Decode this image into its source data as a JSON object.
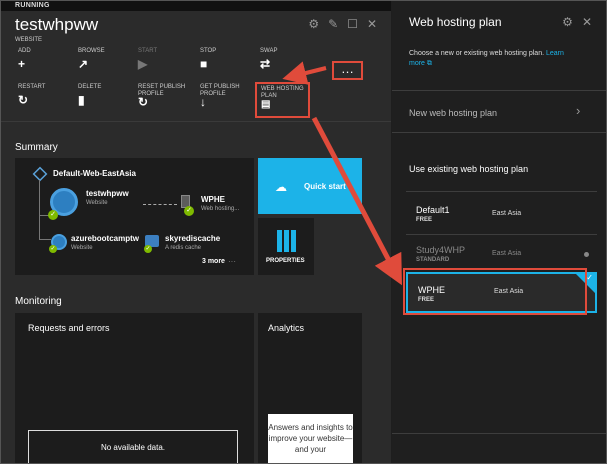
{
  "left": {
    "status": "RUNNING",
    "title": "testwhpww",
    "subtitle": "WEBSITE",
    "commands_row1": [
      {
        "label": "ADD",
        "icon": "plus-icon",
        "glyph": "+"
      },
      {
        "label": "BROWSE",
        "icon": "external-link-icon",
        "glyph": "↗"
      },
      {
        "label": "START",
        "icon": "play-icon",
        "glyph": "▶"
      },
      {
        "label": "STOP",
        "icon": "stop-icon",
        "glyph": "■"
      },
      {
        "label": "SWAP",
        "icon": "swap-icon",
        "glyph": "⇄"
      }
    ],
    "commands_row2": [
      {
        "label": "RESTART",
        "icon": "restart-icon",
        "glyph": "↻"
      },
      {
        "label": "DELETE",
        "icon": "trash-icon",
        "glyph": "▮"
      },
      {
        "label": "RESET PUBLISH PROFILE",
        "icon": "reset-icon",
        "glyph": "↻"
      },
      {
        "label": "GET PUBLISH PROFILE",
        "icon": "download-icon",
        "glyph": "↓"
      },
      {
        "label": "WEB HOSTING PLAN",
        "icon": "hosting-plan-icon",
        "glyph": "▤"
      }
    ],
    "more_button": "…",
    "summary_heading": "Summary",
    "resource_group": "Default-Web-EastAsia",
    "resources": [
      {
        "name": "testwhpww",
        "type": "Website"
      },
      {
        "name": "WPHE",
        "type": "Web hosting..."
      },
      {
        "name": "azurebootcamptw",
        "type": "Website"
      },
      {
        "name": "skyrediscache",
        "type": "A redis cache"
      }
    ],
    "more_link": "3 more",
    "more_dots": "···",
    "quick_start": "Quick start",
    "properties": "PROPERTIES",
    "monitoring_heading": "Monitoring",
    "requests_title": "Requests and errors",
    "no_data": "No available data.",
    "analytics_title": "Analytics",
    "analytics_text": "Answers and insights to improve your website—and your"
  },
  "right": {
    "title": "Web hosting plan",
    "description": "Choose a new or existing web hosting plan.",
    "learn_more": "Learn more",
    "new_plan": "New web hosting plan",
    "use_existing": "Use existing web hosting plan",
    "plans": [
      {
        "name": "Default1",
        "tier": "FREE",
        "location": "East Asia"
      },
      {
        "name": "Study4WHP",
        "tier": "STANDARD",
        "location": "East Asia"
      },
      {
        "name": "WPHE",
        "tier": "FREE",
        "location": "East Asia"
      }
    ]
  },
  "colors": {
    "accent": "#1cb3e8",
    "highlight": "#e04b3b",
    "success": "#7fba00"
  }
}
